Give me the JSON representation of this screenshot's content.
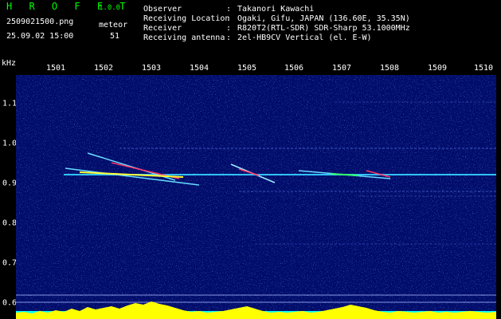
{
  "header": {
    "app_title": "H R O F F T",
    "version": "1.0.0",
    "filename": "2509021500.png",
    "mode": "meteor",
    "datetime": "25.09.02 15:00",
    "count": "51"
  },
  "info": [
    {
      "label": "Observer",
      "value": "Takanori Kawachi"
    },
    {
      "label": "Receiving Location",
      "value": "Ogaki, Gifu, JAPAN (136.60E, 35.35N)"
    },
    {
      "label": "Receiver",
      "value": "R820T2(RTL-SDR) SDR-Sharp 53.1000MHz"
    },
    {
      "label": "Receiving antenna",
      "value": "2el-HB9CV Vertical (el. E-W)"
    }
  ],
  "axes": {
    "unit": "kHz",
    "x_ticks": [
      "1501",
      "1502",
      "1503",
      "1504",
      "1505",
      "1506",
      "1507",
      "1508",
      "1509",
      "1510"
    ],
    "y_ticks": [
      "1.1",
      "1.0",
      "0.9",
      "0.8",
      "0.7",
      "0.6"
    ]
  },
  "colors": {
    "background": "#000000",
    "plot": "#000c6a",
    "title": "#00ff00",
    "carrier": "#33ccff",
    "trail": "#00ffcc",
    "peak": "#ff3366",
    "signal_bars": "#ffff00",
    "baseline": "#00ffff"
  }
}
